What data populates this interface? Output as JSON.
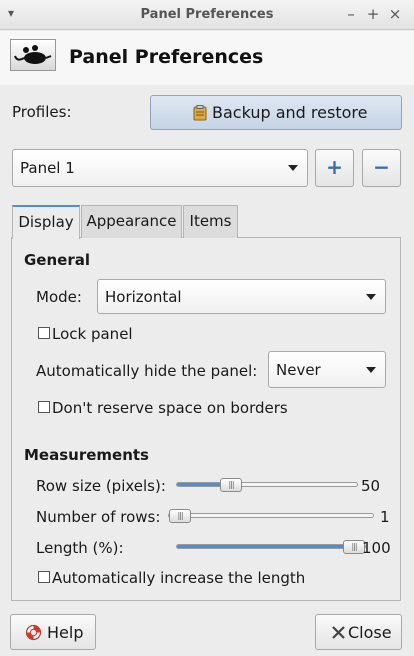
{
  "window": {
    "title": "Panel Preferences",
    "menu_glyph": "▾",
    "minimize_glyph": "–",
    "maximize_glyph": "+",
    "close_glyph": "×"
  },
  "header": {
    "title": "Panel Preferences",
    "icon": "mouse-icon"
  },
  "profiles": {
    "label": "Profiles:",
    "backup_button": "Backup and restore",
    "backup_icon": "clipboard-icon"
  },
  "panel_select": {
    "value": "Panel 1",
    "add_glyph": "+",
    "remove_glyph": "−"
  },
  "tabs": [
    {
      "label": "Display",
      "active": true
    },
    {
      "label": "Appearance",
      "active": false
    },
    {
      "label": "Items",
      "active": false
    }
  ],
  "general": {
    "heading": "General",
    "mode_label": "Mode:",
    "mode_value": "Horizontal",
    "lock_label": "Lock panel",
    "lock_checked": false,
    "autohide_label": "Automatically hide the panel:",
    "autohide_value": "Never",
    "reserve_label": "Don't reserve space on borders",
    "reserve_checked": false
  },
  "measurements": {
    "heading": "Measurements",
    "row_size_label": "Row size (pixels):",
    "row_size_value": "50",
    "row_size_fraction": 0.3,
    "rows_label": "Number of rows:",
    "rows_value": "1",
    "rows_fraction": 0.0,
    "length_label": "Length (%):",
    "length_value": "100",
    "length_fraction": 1.0,
    "auto_length_label": "Automatically increase the length",
    "auto_length_checked": false
  },
  "footer": {
    "help_label": "Help",
    "help_icon": "lifebuoy-icon",
    "close_label": "Close",
    "close_icon": "close-icon"
  },
  "colors": {
    "accent": "#4a90d9",
    "background": "#ececec"
  }
}
